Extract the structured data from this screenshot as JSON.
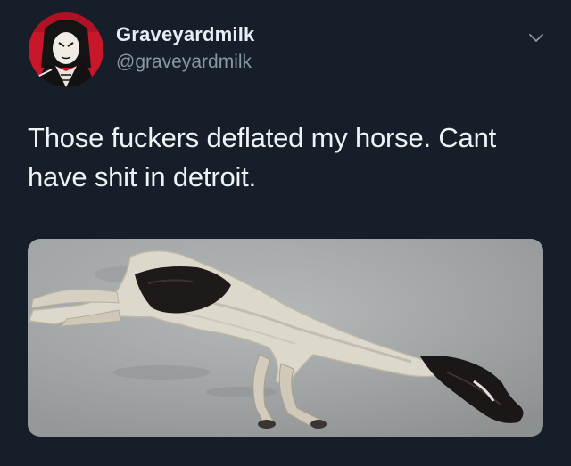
{
  "tweet": {
    "display_name": "Graveyardmilk",
    "handle": "@graveyardmilk",
    "text_line1": "Those fuckers deflated my horse. Cant",
    "text_line2": "have shit in detroit."
  },
  "icons": {
    "menu": "chevron-down-icon"
  },
  "colors": {
    "background": "#151e29",
    "name": "#e8edf2",
    "handle": "#8899a6",
    "text": "#f0f3f6",
    "avatar_red": "#c8172a"
  }
}
